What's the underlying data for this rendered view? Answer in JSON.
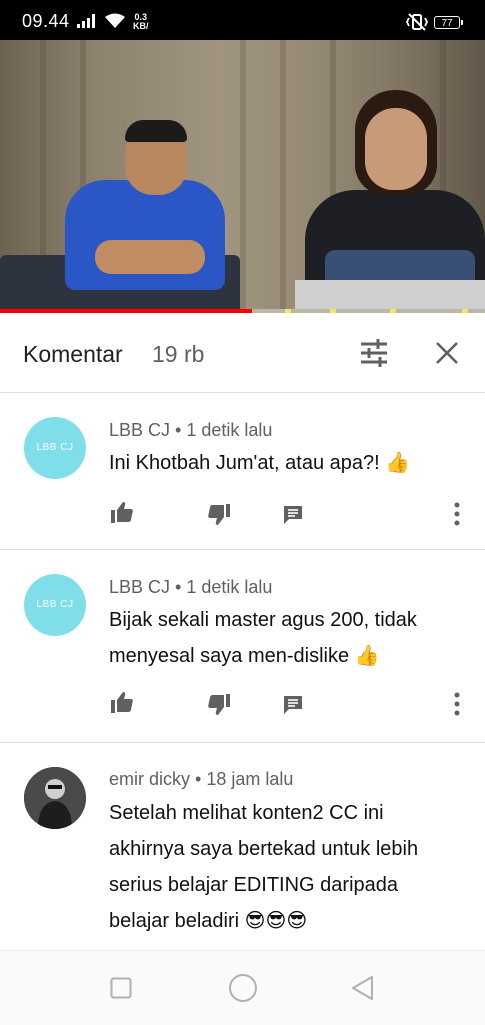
{
  "status_bar": {
    "time": "09.44",
    "net_speed_value": "0.3",
    "net_speed_unit": "KB/",
    "battery": "77",
    "icons": [
      "signal-icon",
      "wifi-icon",
      "vibrate-icon",
      "battery-icon"
    ]
  },
  "video": {
    "progress_fraction": 0.52,
    "colors": {
      "played": "#ff0000",
      "track": "#bdb7a8",
      "ad_marker": "#f5e663"
    }
  },
  "comments_header": {
    "title": "Komentar",
    "count": "19 rb",
    "icons": [
      "filter-sort-icon",
      "close-icon"
    ]
  },
  "comments": [
    {
      "avatar_text": "LBB CJ",
      "author": "LBB CJ",
      "separator": " • ",
      "time": "1 detik lalu",
      "text_lines": [
        "Ini Khotbah Jum'at, atau apa?! 👍"
      ]
    },
    {
      "avatar_text": "LBB CJ",
      "author": "LBB CJ",
      "separator": " • ",
      "time": "1 detik lalu",
      "text_lines": [
        "Bijak sekali master agus 200, tidak",
        "menyesal saya men-dislike 👍"
      ]
    },
    {
      "avatar_text": "",
      "author": "emir dicky",
      "separator": " • ",
      "time": "18 jam lalu",
      "text_lines": [
        "Setelah melihat konten2 CC ini",
        "akhirnya saya bertekad untuk lebih",
        "serius belajar EDITING daripada",
        "belajar beladiri 😎😎😎"
      ]
    }
  ],
  "comment_actions": [
    "like-icon",
    "dislike-icon",
    "reply-icon",
    "more-options-icon"
  ],
  "nav_bar": [
    "recents-button",
    "home-button",
    "back-button"
  ],
  "colors": {
    "avatar_bg": "#80deea",
    "meta_text": "#606060",
    "icon": "#606060"
  }
}
